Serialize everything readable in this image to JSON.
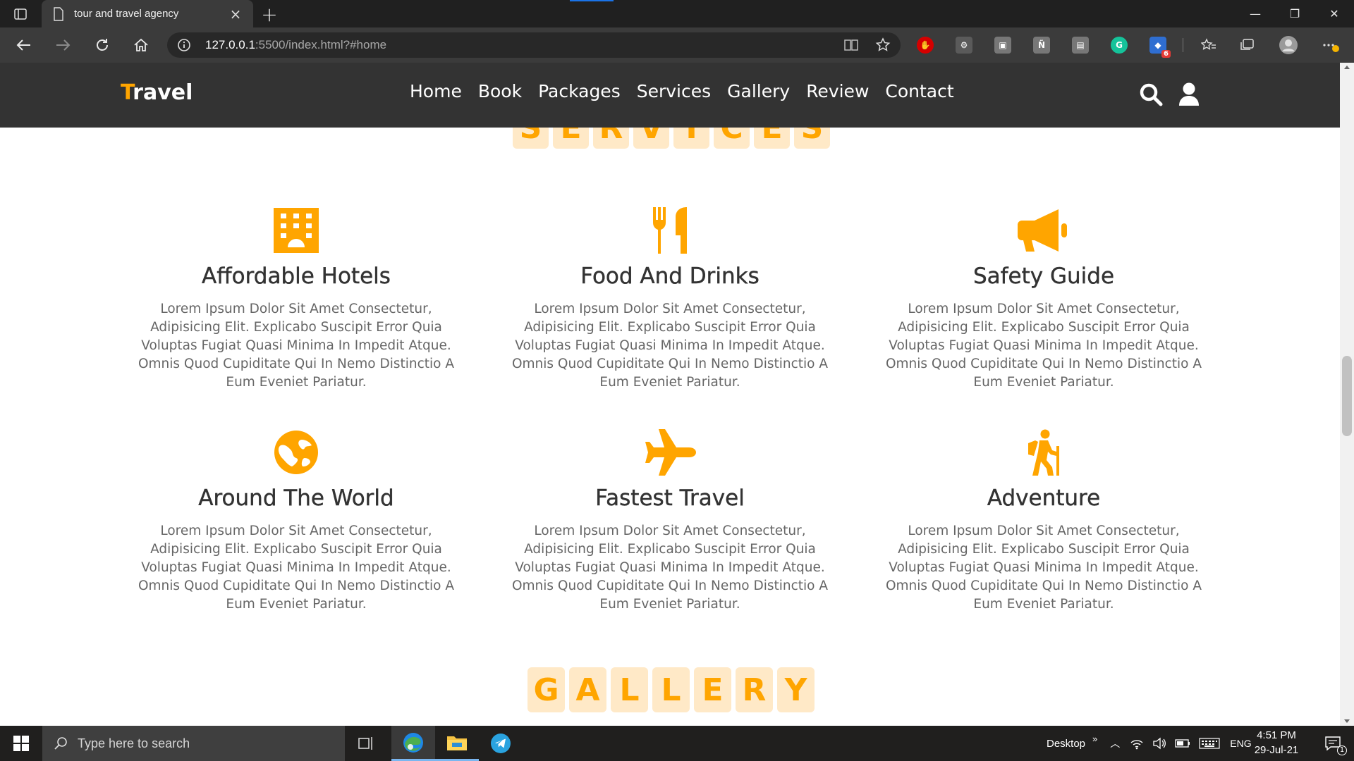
{
  "browser": {
    "tab_title": "tour and travel agency",
    "url_host": "127.0.0.1",
    "url_path": ":5500/index.html?#home",
    "extension_badge": "6"
  },
  "site": {
    "logo_first": "T",
    "logo_rest": "ravel",
    "nav": [
      "Home",
      "Book",
      "Packages",
      "Services",
      "Gallery",
      "Review",
      "Contact"
    ],
    "services_heading": [
      "S",
      "E",
      "R",
      "V",
      "I",
      "C",
      "E",
      "S"
    ],
    "gallery_heading": [
      "G",
      "A",
      "L",
      "L",
      "E",
      "R",
      "Y"
    ],
    "accent_color": "#ffa500",
    "header_color": "#333333",
    "services": [
      {
        "icon": "hotel-icon",
        "title": "Affordable Hotels",
        "text": "Lorem Ipsum Dolor Sit Amet Consectetur, Adipisicing Elit. Explicabo Suscipit Error Quia Voluptas Fugiat Quasi Minima In Impedit Atque. Omnis Quod Cupiditate Qui In Nemo Distinctio A Eum Eveniet Pariatur."
      },
      {
        "icon": "utensils-icon",
        "title": "Food And Drinks",
        "text": "Lorem Ipsum Dolor Sit Amet Consectetur, Adipisicing Elit. Explicabo Suscipit Error Quia Voluptas Fugiat Quasi Minima In Impedit Atque. Omnis Quod Cupiditate Qui In Nemo Distinctio A Eum Eveniet Pariatur."
      },
      {
        "icon": "bullhorn-icon",
        "title": "Safety Guide",
        "text": "Lorem Ipsum Dolor Sit Amet Consectetur, Adipisicing Elit. Explicabo Suscipit Error Quia Voluptas Fugiat Quasi Minima In Impedit Atque. Omnis Quod Cupiditate Qui In Nemo Distinctio A Eum Eveniet Pariatur."
      },
      {
        "icon": "globe-icon",
        "title": "Around The World",
        "text": "Lorem Ipsum Dolor Sit Amet Consectetur, Adipisicing Elit. Explicabo Suscipit Error Quia Voluptas Fugiat Quasi Minima In Impedit Atque. Omnis Quod Cupiditate Qui In Nemo Distinctio A Eum Eveniet Pariatur."
      },
      {
        "icon": "plane-icon",
        "title": "Fastest Travel",
        "text": "Lorem Ipsum Dolor Sit Amet Consectetur, Adipisicing Elit. Explicabo Suscipit Error Quia Voluptas Fugiat Quasi Minima In Impedit Atque. Omnis Quod Cupiditate Qui In Nemo Distinctio A Eum Eveniet Pariatur."
      },
      {
        "icon": "hiking-icon",
        "title": "Adventure",
        "text": "Lorem Ipsum Dolor Sit Amet Consectetur, Adipisicing Elit. Explicabo Suscipit Error Quia Voluptas Fugiat Quasi Minima In Impedit Atque. Omnis Quod Cupiditate Qui In Nemo Distinctio A Eum Eveniet Pariatur."
      }
    ]
  },
  "taskbar": {
    "search_placeholder": "Type here to search",
    "desktop_label": "Desktop",
    "language": "ENG",
    "time": "4:51 PM",
    "date": "29-Jul-21",
    "notification_count": "1"
  }
}
